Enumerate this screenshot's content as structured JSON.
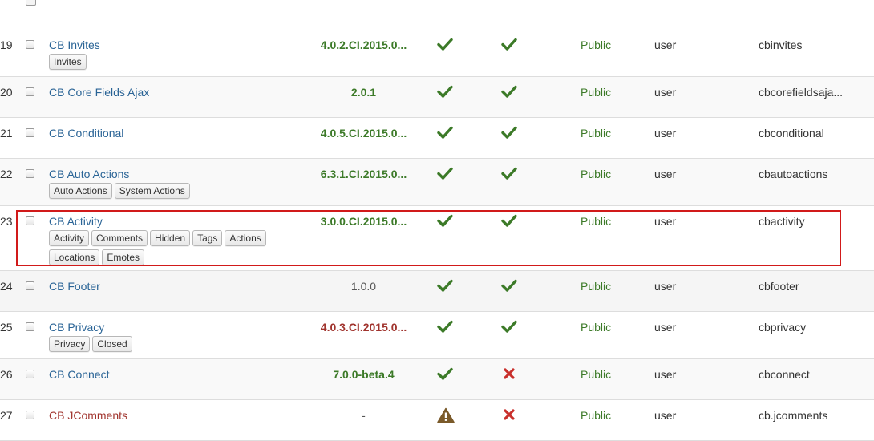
{
  "status_icons": {
    "check": "check-icon",
    "cross": "cross-icon",
    "warning": "warning-icon"
  },
  "colors": {
    "link": "#2a6496",
    "link_error": "#a0332d",
    "version_ok": "#3c7a28",
    "version_outdated": "#a0332d",
    "check": "#3c7a28",
    "cross": "#c9302c",
    "warning": "#7a5a2a",
    "highlight_border": "#d11a1a"
  },
  "rows": [
    {
      "id": "19",
      "name": "CB Invites",
      "version": "4.0.2.CI.2015.0...",
      "access": "Public",
      "type": "user",
      "element": "cbinvites",
      "tags": [
        "Invites"
      ]
    },
    {
      "id": "20",
      "name": "CB Core Fields Ajax",
      "version": "2.0.1",
      "access": "Public",
      "type": "user",
      "element": "cbcorefieldsaja...",
      "tags": []
    },
    {
      "id": "21",
      "name": "CB Conditional",
      "version": "4.0.5.CI.2015.0...",
      "access": "Public",
      "type": "user",
      "element": "cbconditional",
      "tags": []
    },
    {
      "id": "22",
      "name": "CB Auto Actions",
      "version": "6.3.1.CI.2015.0...",
      "access": "Public",
      "type": "user",
      "element": "cbautoactions",
      "tags": [
        "Auto Actions",
        "System Actions"
      ]
    },
    {
      "id": "23",
      "name": "CB Activity",
      "version": "3.0.0.CI.2015.0...",
      "access": "Public",
      "type": "user",
      "element": "cbactivity",
      "tags": [
        "Activity",
        "Comments",
        "Hidden",
        "Tags",
        "Actions",
        "Locations",
        "Emotes"
      ]
    },
    {
      "id": "24",
      "name": "CB Footer",
      "version": "1.0.0",
      "access": "Public",
      "type": "user",
      "element": "cbfooter",
      "tags": []
    },
    {
      "id": "25",
      "name": "CB Privacy",
      "version": "4.0.3.CI.2015.0...",
      "access": "Public",
      "type": "user",
      "element": "cbprivacy",
      "tags": [
        "Privacy",
        "Closed"
      ]
    },
    {
      "id": "26",
      "name": "CB Connect",
      "version": "7.0.0-beta.4",
      "access": "Public",
      "type": "user",
      "element": "cbconnect",
      "tags": []
    },
    {
      "id": "27",
      "name": "CB JComments",
      "version": "-",
      "access": "Public",
      "type": "user",
      "element": "cb.jcomments",
      "tags": []
    }
  ]
}
